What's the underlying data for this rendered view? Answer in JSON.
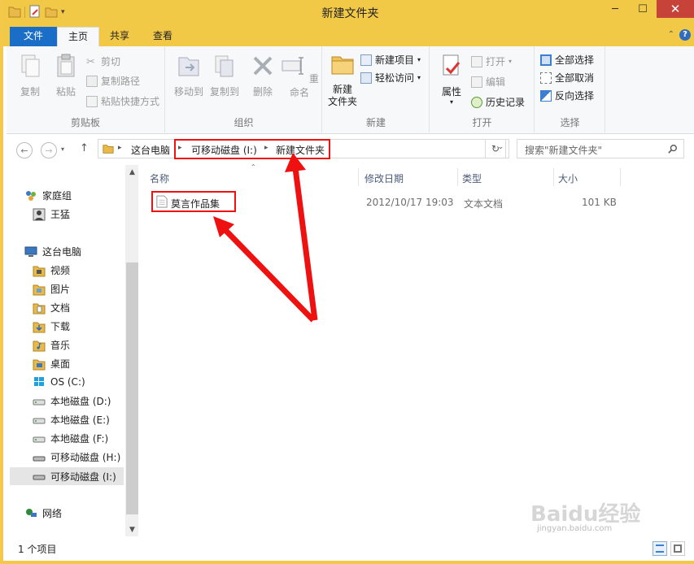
{
  "window": {
    "title": "新建文件夹",
    "controls": {
      "minimize": "─",
      "maximize": "☐",
      "close": "✕"
    }
  },
  "tabs": {
    "file": "文件",
    "home": "主页",
    "share": "共享",
    "view": "查看"
  },
  "ribbon": {
    "clipboard": {
      "label": "剪贴板",
      "copy": "复制",
      "paste": "粘贴",
      "cut": "剪切",
      "copy_path": "复制路径",
      "paste_shortcut": "粘贴快捷方式"
    },
    "organize": {
      "label": "组织",
      "move_to": "移动到",
      "copy_to": "复制到",
      "delete": "删除",
      "rename": "重命名"
    },
    "new": {
      "label": "新建",
      "new_folder_line1": "新建",
      "new_folder_line2": "文件夹",
      "new_item": "新建项目",
      "easy_access": "轻松访问"
    },
    "open": {
      "label": "打开",
      "properties": "属性",
      "open": "打开",
      "edit": "编辑",
      "history": "历史记录"
    },
    "select": {
      "label": "选择",
      "select_all": "全部选择",
      "select_none": "全部取消",
      "invert": "反向选择"
    }
  },
  "address": {
    "crumbs": [
      "这台电脑",
      "可移动磁盘 (I:)",
      "新建文件夹"
    ],
    "search_placeholder": "搜索\"新建文件夹\""
  },
  "nav": {
    "homegroup": "家庭组",
    "homegroup_user": "王猛",
    "this_pc": "这台电脑",
    "videos": "视频",
    "pictures": "图片",
    "documents": "文档",
    "downloads": "下载",
    "music": "音乐",
    "desktop": "桌面",
    "os": "OS (C:)",
    "disk_d": "本地磁盘 (D:)",
    "disk_e": "本地磁盘 (E:)",
    "disk_f": "本地磁盘 (F:)",
    "removable_h": "可移动磁盘 (H:)",
    "removable_i": "可移动磁盘 (I:)",
    "network": "网络"
  },
  "columns": {
    "name": "名称",
    "date": "修改日期",
    "type": "类型",
    "size": "大小"
  },
  "files": [
    {
      "name": "莫言作品集",
      "date": "2012/10/17 19:03",
      "type": "文本文档",
      "size": "101 KB"
    }
  ],
  "status": {
    "count": "1 个项目"
  },
  "watermark": {
    "brand": "Baidu经验",
    "url": "jingyan.baidu.com"
  },
  "colors": {
    "titlebar": "#f2c847",
    "file_tab": "#1a6ec7",
    "annotation": "#ef1010"
  }
}
